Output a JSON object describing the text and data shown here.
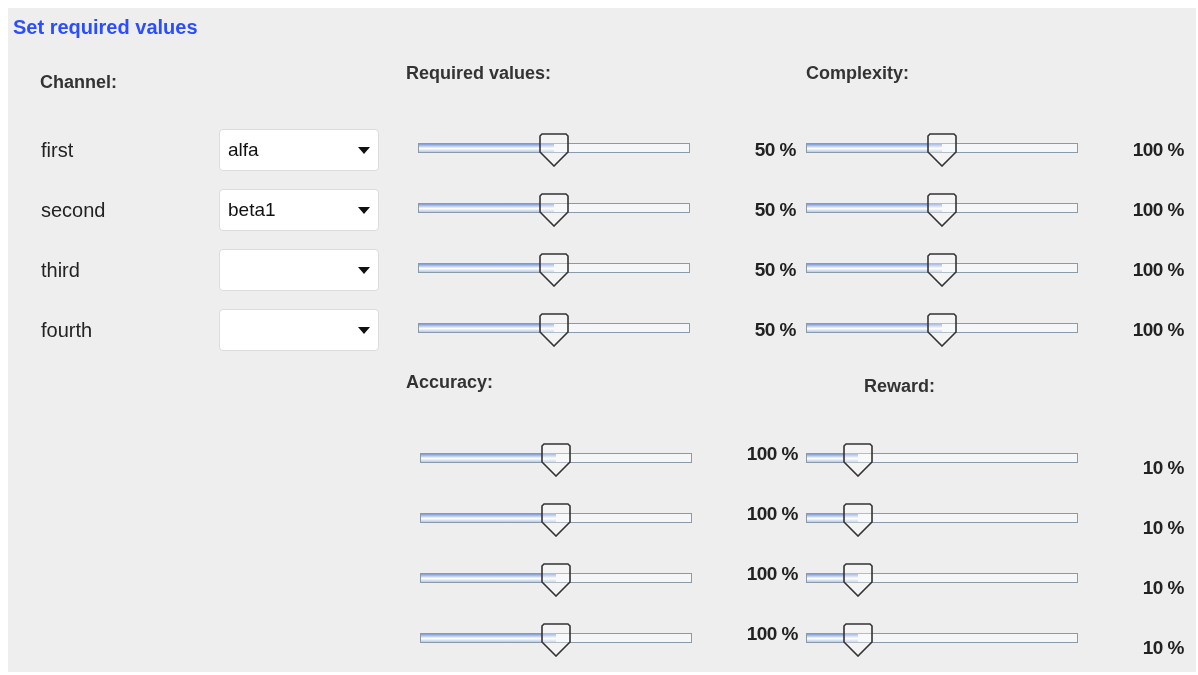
{
  "title": "Set required values",
  "channel_header": "Channel:",
  "channels": [
    {
      "label": "first",
      "value": "alfa"
    },
    {
      "label": "second",
      "value": "beta1"
    },
    {
      "label": "third"
    },
    {
      "label": "fourth"
    }
  ],
  "groups": [
    {
      "title": "Required values:",
      "sliders": [
        {
          "level": 0.5,
          "reading": "50 %"
        },
        {
          "level": 0.5,
          "reading": "50 %"
        },
        {
          "level": 0.5,
          "reading": "50 %"
        },
        {
          "level": 0.5,
          "reading": "50 %"
        }
      ]
    },
    {
      "title": "Complexity:",
      "sliders": [
        {
          "level": 0.5,
          "reading": "100 %"
        },
        {
          "level": 0.5,
          "reading": "100 %"
        },
        {
          "level": 0.5,
          "reading": "100 %"
        },
        {
          "level": 0.5,
          "reading": "100 %"
        }
      ]
    },
    {
      "title": "Accuracy:",
      "sliders": [
        {
          "level": 0.5,
          "reading": "100 %"
        },
        {
          "level": 0.5,
          "reading": "100 %"
        },
        {
          "level": 0.5,
          "reading": "100 %"
        },
        {
          "level": 0.5,
          "reading": "100 %"
        }
      ]
    },
    {
      "title": "Reward:",
      "sliders": [
        {
          "level": 0.19,
          "reading": "10 %"
        },
        {
          "level": 0.19,
          "reading": "10 %"
        },
        {
          "level": 0.19,
          "reading": "10 %"
        },
        {
          "level": 0.19,
          "reading": "10 %"
        }
      ]
    }
  ]
}
